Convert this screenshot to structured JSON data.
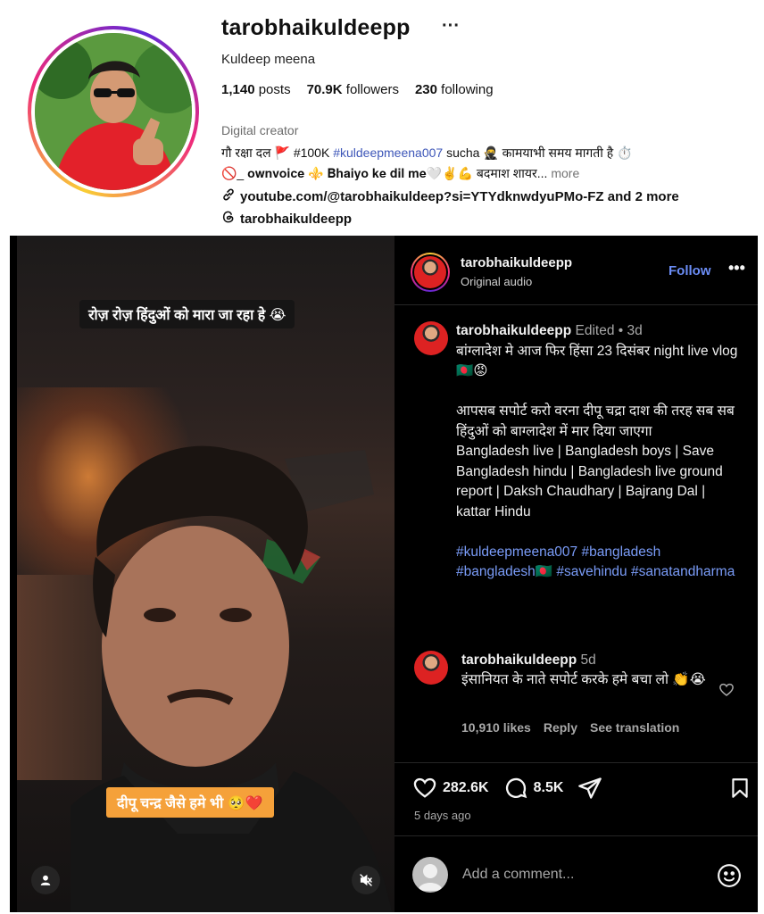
{
  "profile": {
    "username": "tarobhaikuldeepp",
    "more_icon": "···",
    "full_name": "Kuldeep meena",
    "posts_count": "1,140",
    "posts_label": "posts",
    "followers_count": "70.9K",
    "followers_label": "followers",
    "following_count": "230",
    "following_label": "following",
    "category": "Digital creator",
    "bio_line1_a": "गौ रक्षा दल 🚩 #100K ",
    "bio_line1_tag": "#kuldeepmeena007",
    "bio_line1_b": " sucha 🥷 कामयाभी समय मागती है ⏱️",
    "bio_line2": "🚫_ 𝐨𝐰𝐧𝐯𝐨𝐢𝐜𝐞 ⚜️ 𝐁𝐡𝐚𝐢𝐲𝐨 𝐤𝐞 𝐝𝐢𝐥 𝐦𝐞🤍✌️💪 बदमाश शायर...",
    "bio_more": " more",
    "link_text": "youtube.com/@tarobhaikuldeep?si=YTYdknwdyuPMo-FZ and 2 more",
    "threads_handle": "tarobhaikuldeepp"
  },
  "video": {
    "caption_top": "रोज़ रोज़ हिंदुओं को मारा जा रहा हे 😭",
    "caption_bottom": "दीपू चन्द्र जैसे हमे भी 🥺❤️"
  },
  "post": {
    "author": "tarobhaikuldeepp",
    "audio": "Original audio",
    "follow_label": "Follow",
    "more_icon": "•••",
    "caption_user": "tarobhaikuldeepp",
    "caption_meta": " Edited • 3d",
    "caption_p1": "बांग्लादेश मे आज फिर हिंसा 23 दिसंबर night live vlog 🇧🇩😡",
    "caption_p2": "आपसब सपोर्ट करो वरना दीपू चद्रा दाश की तरह सब सब हिंदुओं को बाग्लादेश में मार दिया जाएगा",
    "caption_p3": " Bangladesh live | Bangladesh boys | Save Bangladesh hindu | Bangladesh live ground report | Daksh Chaudhary | Bajrang Dal | kattar Hindu",
    "hashtag1": "#kuldeepmeena007",
    "hashtag2": "#bangladesh",
    "hashtag3": "#bangladesh🇧🇩",
    "hashtag4": "#savehindu",
    "hashtag5": "#sanatandharma",
    "comment_user": "tarobhaikuldeepp",
    "comment_time": " 5d",
    "comment_text": "इंसानियत के नाते सपोर्ट करके हमे बचा लो 👏😭",
    "comment_likes": "10,910 likes",
    "comment_reply": "Reply",
    "comment_translate": "See translation",
    "likes": "282.6K",
    "comments": "8.5K",
    "time_ago": "5 days ago",
    "add_comment_placeholder": "Add a comment..."
  }
}
